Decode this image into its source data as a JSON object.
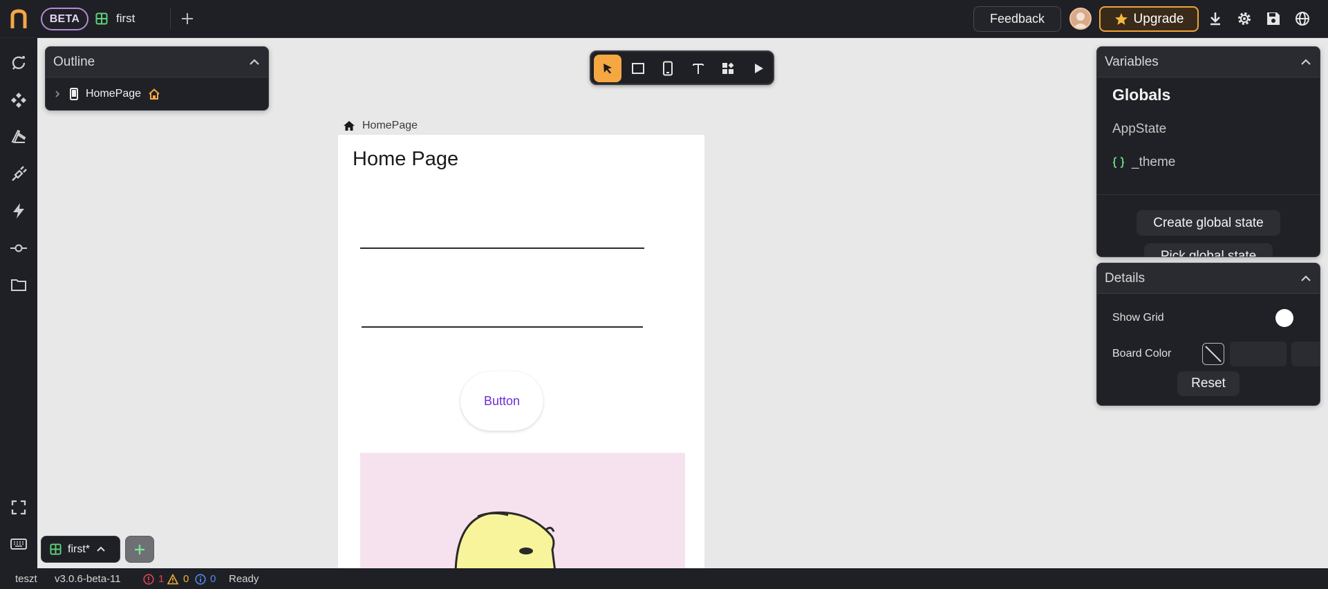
{
  "topbar": {
    "beta_label": "BETA",
    "tab_label": "first",
    "feedback_label": "Feedback",
    "upgrade_label": "Upgrade"
  },
  "outline": {
    "title": "Outline",
    "root_item": "HomePage"
  },
  "canvas": {
    "breadcrumb": "HomePage",
    "page_title": "Home Page",
    "button_label": "Button"
  },
  "variables": {
    "title": "Variables",
    "section": "Globals",
    "app_state": "AppState",
    "theme": "_theme",
    "create_label": "Create global state",
    "pick_label": "Pick global state"
  },
  "details": {
    "title": "Details",
    "show_grid_label": "Show Grid",
    "board_color_label": "Board Color",
    "reset_label": "Reset"
  },
  "bottom": {
    "project_label": "first*"
  },
  "statusbar": {
    "user": "teszt",
    "version": "v3.0.6-beta-11",
    "errors": "1",
    "warnings": "0",
    "infos": "0",
    "status": "Ready"
  },
  "icons": {
    "logo": "app-logo",
    "tab": "grid-table-icon",
    "add_tab": "plus-icon",
    "download": "download-icon",
    "settings": "gear-icon",
    "save": "save-icon",
    "language": "globe-icon"
  },
  "colors": {
    "accent": "#f5a742",
    "beta_border": "#b68ad8",
    "button_text": "#6a2fd0",
    "error": "#e0454d",
    "warning": "#f2b233",
    "info": "#4d8cf0"
  }
}
